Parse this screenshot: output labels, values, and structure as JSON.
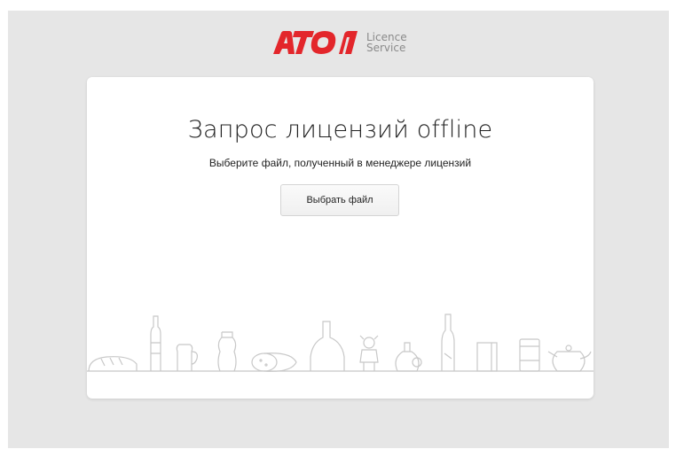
{
  "brand": {
    "logo_text": "АТОЛ",
    "product_line1": "Licence",
    "product_line2": "Service",
    "accent_color": "#e3262b"
  },
  "card": {
    "title": "Запрос лицензий offline",
    "subtitle": "Выберите файл, полученный в менеджере лицензий",
    "button_label": "Выбрать файл"
  },
  "illustration": {
    "items": [
      "bread-icon",
      "bottle-icon",
      "jug-icon",
      "jar-icon",
      "sausage-icon",
      "cognac-bottle-icon",
      "toy-icon",
      "perfume-icon",
      "champagne-icon",
      "box-icon",
      "can-icon",
      "teapot-icon"
    ]
  }
}
